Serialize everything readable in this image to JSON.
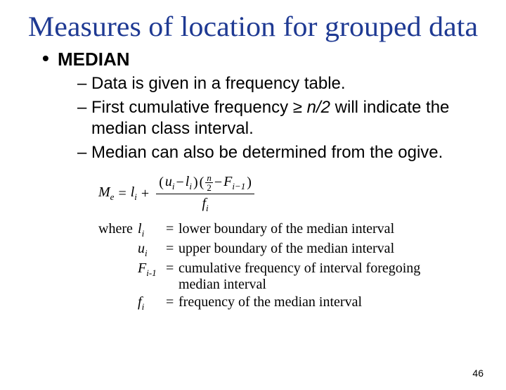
{
  "title": "Measures of location for grouped data",
  "section": {
    "heading": "MEDIAN"
  },
  "bullets": {
    "b1": "Data is given in a frequency table.",
    "b2a": "First cumulative frequency ≥ ",
    "b2b": "n/2",
    "b2c": " will indicate the median class interval.",
    "b3": "Median can also be determined from the ogive."
  },
  "formula": {
    "lhs": "M",
    "lhs_sub": "e",
    "eq": " = ",
    "li": "l",
    "li_sub": "i",
    "plus": " + ",
    "ui": "u",
    "ui_sub": "i",
    "minus": " − ",
    "lparen": "(",
    "rparen": ")",
    "n": "n",
    "two": "2",
    "F": "F",
    "F_sub": "i−1",
    "fi": "f",
    "fi_sub": "i"
  },
  "where_label": "where",
  "defs": {
    "li_sym": "l",
    "li_sub": "i",
    "li_desc": "lower boundary of the median interval",
    "ui_sym": "u",
    "ui_sub": "i",
    "ui_desc": "upper boundary of the median interval",
    "F_sym": "F",
    "F_sub": "i-1",
    "F_desc": "cumulative frequency of interval foregoing median interval",
    "fi_sym": "f",
    "fi_sub": "i",
    "fi_desc": "frequency of the median interval",
    "eq": "="
  },
  "page_number": "46"
}
